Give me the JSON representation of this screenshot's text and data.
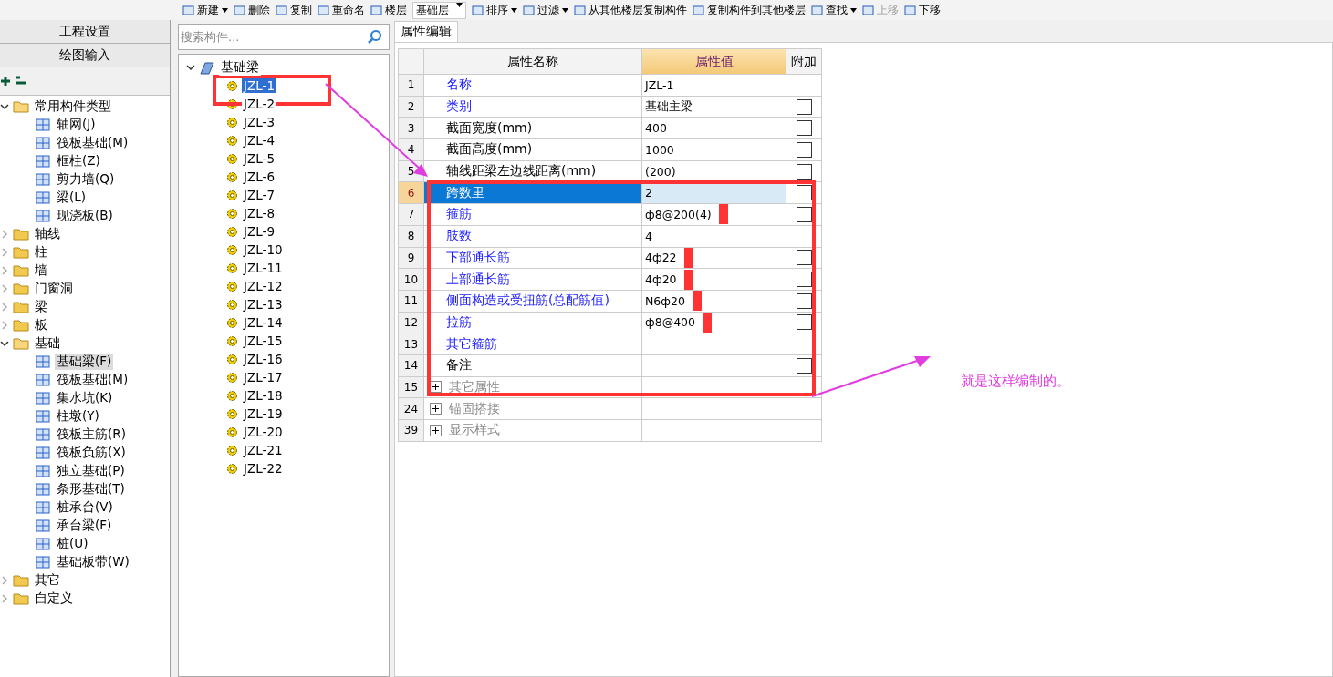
{
  "toolbar": [
    {
      "label": "新建",
      "dropdown": true
    },
    {
      "label": "删除",
      "dropdown": false
    },
    {
      "label": "复制",
      "dropdown": false
    },
    {
      "label": "重命名",
      "dropdown": false
    },
    {
      "label": "楼层",
      "dropdown": false
    },
    {
      "label": "基础层",
      "dropdown": true,
      "kind": "select"
    },
    {
      "label": "排序",
      "dropdown": true
    },
    {
      "label": "过滤",
      "dropdown": true
    },
    {
      "label": "从其他楼层复制构件",
      "dropdown": false
    },
    {
      "label": "复制构件到其他楼层",
      "dropdown": false
    },
    {
      "label": "查找",
      "dropdown": true
    },
    {
      "label": "上移",
      "dropdown": false,
      "disabled": true
    },
    {
      "label": "下移",
      "dropdown": false,
      "disabled": false
    }
  ],
  "nav_buttons": [
    "工程设置",
    "绘图输入"
  ],
  "category_tree": [
    {
      "label": "常用构件类型",
      "expanded": true,
      "children": [
        {
          "label": "轴网(J)",
          "selected": false
        },
        {
          "label": "筏板基础(M)",
          "selected": false
        },
        {
          "label": "框柱(Z)",
          "selected": false
        },
        {
          "label": "剪力墙(Q)",
          "selected": false
        },
        {
          "label": "梁(L)",
          "selected": false
        },
        {
          "label": "现浇板(B)",
          "selected": false
        }
      ]
    },
    {
      "label": "轴线",
      "expanded": false
    },
    {
      "label": "柱",
      "expanded": false
    },
    {
      "label": "墙",
      "expanded": false
    },
    {
      "label": "门窗洞",
      "expanded": false
    },
    {
      "label": "梁",
      "expanded": false
    },
    {
      "label": "板",
      "expanded": false
    },
    {
      "label": "基础",
      "expanded": true,
      "children": [
        {
          "label": "基础梁(F)",
          "selected": true
        },
        {
          "label": "筏板基础(M)",
          "selected": false
        },
        {
          "label": "集水坑(K)",
          "selected": false
        },
        {
          "label": "柱墩(Y)",
          "selected": false
        },
        {
          "label": "筏板主筋(R)",
          "selected": false
        },
        {
          "label": "筏板负筋(X)",
          "selected": false
        },
        {
          "label": "独立基础(P)",
          "selected": false
        },
        {
          "label": "条形基础(T)",
          "selected": false
        },
        {
          "label": "桩承台(V)",
          "selected": false
        },
        {
          "label": "承台梁(F)",
          "selected": false
        },
        {
          "label": "桩(U)",
          "selected": false
        },
        {
          "label": "基础板带(W)",
          "selected": false
        }
      ]
    },
    {
      "label": "其它",
      "expanded": false
    },
    {
      "label": "自定义",
      "expanded": false
    }
  ],
  "search": {
    "placeholder": "搜索构件..."
  },
  "component_tree": {
    "label": "基础梁",
    "expanded": true,
    "children": [
      {
        "label": "JZL-1",
        "selected": true
      },
      {
        "label": "JZL-2",
        "selected": false
      },
      {
        "label": "JZL-3",
        "selected": false
      },
      {
        "label": "JZL-4",
        "selected": false
      },
      {
        "label": "JZL-5",
        "selected": false
      },
      {
        "label": "JZL-6",
        "selected": false
      },
      {
        "label": "JZL-7",
        "selected": false
      },
      {
        "label": "JZL-8",
        "selected": false
      },
      {
        "label": "JZL-9",
        "selected": false
      },
      {
        "label": "JZL-10",
        "selected": false
      },
      {
        "label": "JZL-11",
        "selected": false
      },
      {
        "label": "JZL-12",
        "selected": false
      },
      {
        "label": "JZL-13",
        "selected": false
      },
      {
        "label": "JZL-14",
        "selected": false
      },
      {
        "label": "JZL-15",
        "selected": false
      },
      {
        "label": "JZL-16",
        "selected": false
      },
      {
        "label": "JZL-17",
        "selected": false
      },
      {
        "label": "JZL-18",
        "selected": false
      },
      {
        "label": "JZL-19",
        "selected": false
      },
      {
        "label": "JZL-20",
        "selected": false
      },
      {
        "label": "JZL-21",
        "selected": false
      },
      {
        "label": "JZL-22",
        "selected": false
      }
    ]
  },
  "tabs": [
    {
      "label": "属性编辑",
      "selected": true
    }
  ],
  "table": {
    "columns": [
      "属性名称",
      "属性值",
      "附加"
    ],
    "rows": [
      {
        "index": "1",
        "name": "名称",
        "kind": "public",
        "value": "JZL-1",
        "selected": false
      },
      {
        "index": "2",
        "name": "类别",
        "kind": "public",
        "value": "基础主梁",
        "checked": false,
        "selected": false
      },
      {
        "index": "3",
        "name": "截面宽度(mm)",
        "kind": "private",
        "value": "400",
        "checked": false,
        "selected": false
      },
      {
        "index": "4",
        "name": "截面高度(mm)",
        "kind": "private",
        "value": "1000",
        "checked": false,
        "selected": false
      },
      {
        "index": "5",
        "name": "轴线距梁左边线距离(mm)",
        "kind": "private",
        "value": "(200)",
        "checked": false,
        "selected": false
      },
      {
        "index": "6",
        "name": "跨数里",
        "kind": "public",
        "value": "2",
        "checked": false,
        "selected": true
      },
      {
        "index": "7",
        "name": "箍筋",
        "kind": "public",
        "value": "ф8@200(4)",
        "checked": false,
        "selected": false,
        "marked": true
      },
      {
        "index": "8",
        "name": "肢数",
        "kind": "public",
        "value": "4",
        "selected": false
      },
      {
        "index": "9",
        "name": "下部通长筋",
        "kind": "public",
        "value": "4ф22",
        "checked": false,
        "selected": false,
        "marked": true
      },
      {
        "index": "10",
        "name": "上部通长筋",
        "kind": "public",
        "value": "4ф20",
        "checked": false,
        "selected": false,
        "marked": true
      },
      {
        "index": "11",
        "name": "侧面构造或受扭筋(总配筋值)",
        "kind": "public",
        "value": "N6ф20",
        "checked": false,
        "selected": false,
        "marked": true
      },
      {
        "index": "12",
        "name": "拉筋",
        "kind": "public",
        "value": "ф8@400",
        "checked": false,
        "selected": false,
        "marked": true
      },
      {
        "index": "13",
        "name": "其它箍筋",
        "kind": "public",
        "selected": false
      },
      {
        "index": "14",
        "name": "备注",
        "kind": "private",
        "checked": false,
        "selected": false
      },
      {
        "index": "15",
        "name": "其它属性",
        "kind": "group",
        "expanded": false,
        "selected": false
      },
      {
        "index": "24",
        "name": "锚固搭接",
        "kind": "group",
        "expanded": false,
        "selected": false
      },
      {
        "index": "39",
        "name": "显示样式",
        "kind": "group",
        "expanded": false,
        "selected": false
      }
    ]
  },
  "annotation": {
    "note": "就是这样编制的。"
  }
}
